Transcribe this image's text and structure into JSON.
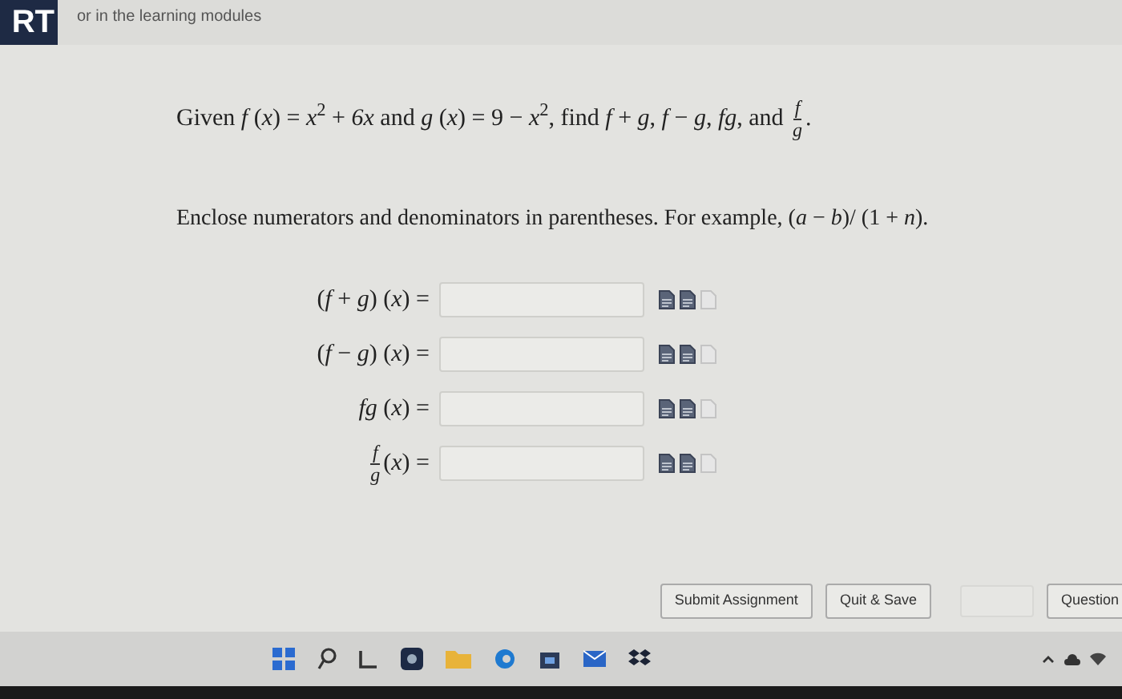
{
  "header": {
    "logo_text": "RT",
    "note": "or in the learning modules"
  },
  "question": {
    "intro": "Given *f* (*x*) = *x*$^{2}$ + *6x* and *g* (*x*) = 9 − *x*$^{2}$, find *f* + *g*, *f* − *g*, *fg*, and ",
    "intro_fraction": {
      "num": "f",
      "den": "g"
    },
    "intro_end": ".",
    "instruction": "Enclose numerators and denominators in parentheses. For example, (*a* − *b*)/ (1 + *n*).",
    "answers": [
      {
        "kind": "plain",
        "label": "(*f* + *g*) (*x*) ="
      },
      {
        "kind": "plain",
        "label": "(*f* − *g*) (*x*) ="
      },
      {
        "kind": "plain",
        "label": "*fg* (*x*) ="
      },
      {
        "kind": "fraction",
        "num": "f",
        "den": "g",
        "label": "(*x*) ="
      }
    ]
  },
  "footer": {
    "buttons": [
      {
        "label": "Submit Assignment",
        "disabled": false
      },
      {
        "label": "Quit & Save",
        "disabled": false
      }
    ],
    "extra_button": {
      "disabled": true
    },
    "cut_button": "Question"
  }
}
